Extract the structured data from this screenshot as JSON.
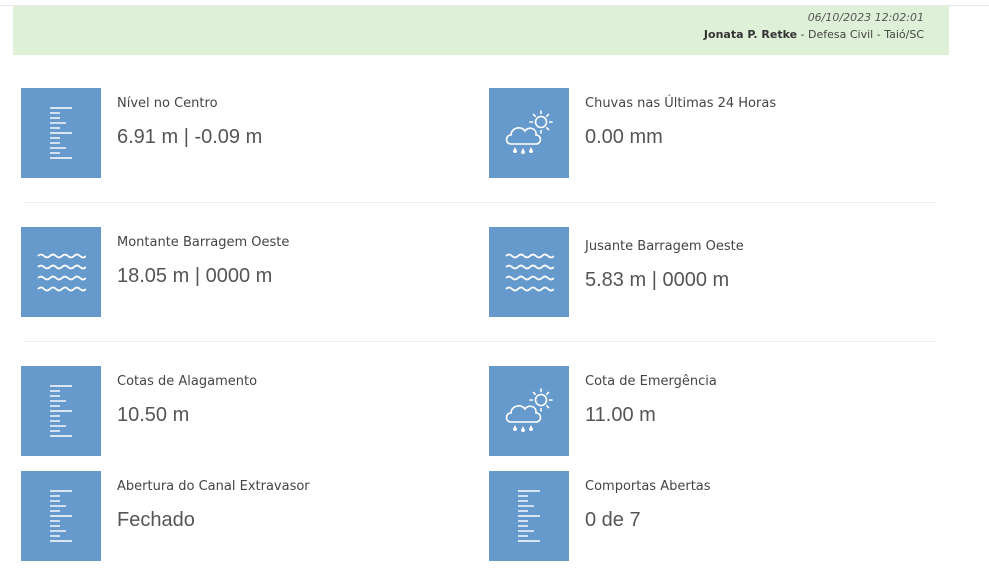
{
  "header": {
    "timestamp": "06/10/2023 12:02:01",
    "user_name": "Jonata P. Retke",
    "user_org": "Defesa Civil - Taió/SC"
  },
  "colors": {
    "header_bg": "#dff0d8",
    "icon_bg": "#6699cc"
  },
  "cards": [
    {
      "icon": "ruler-gauge-icon",
      "label": "Nível no Centro",
      "value": "6.91 m | -0.09 m"
    },
    {
      "icon": "cloud-rain-sun-icon",
      "label": "Chuvas nas Últimas 24 Horas",
      "value": "0.00 mm"
    },
    {
      "icon": "water-waves-icon",
      "label": "Montante Barragem Oeste",
      "value": "18.05 m | 0000 m"
    },
    {
      "icon": "water-waves-icon",
      "label": "Jusante Barragem Oeste",
      "value": "5.83 m | 0000 m"
    },
    {
      "icon": "ruler-gauge-icon",
      "label": "Cotas de Alagamento",
      "value": "10.50 m"
    },
    {
      "icon": "cloud-rain-sun-icon",
      "label": "Cota de Emergência",
      "value": "11.00 m"
    },
    {
      "icon": "ruler-gauge-icon",
      "label": "Abertura do Canal Extravasor",
      "value": "Fechado"
    },
    {
      "icon": "ruler-gauge-icon",
      "label": "Comportas Abertas",
      "value": "0 de 7"
    }
  ]
}
